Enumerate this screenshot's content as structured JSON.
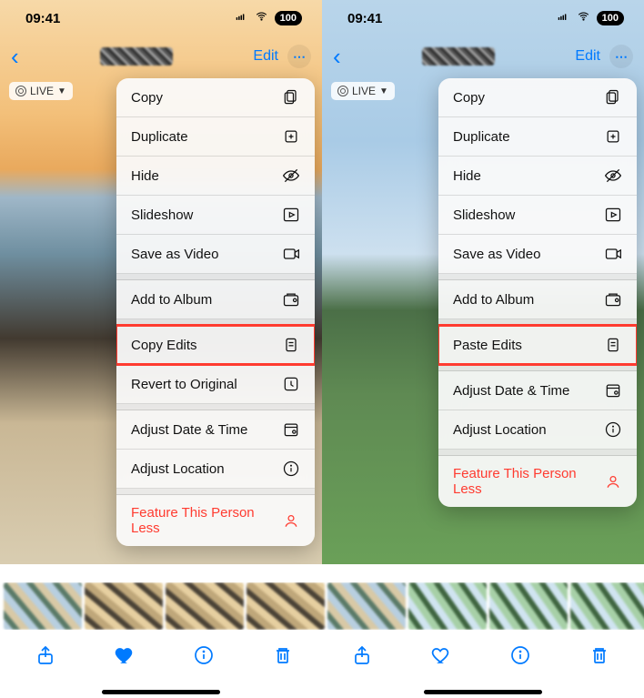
{
  "status": {
    "time": "09:41",
    "battery": "100"
  },
  "nav": {
    "edit": "Edit"
  },
  "live_badge": "LIVE",
  "menu_common": {
    "copy": "Copy",
    "duplicate": "Duplicate",
    "hide": "Hide",
    "slideshow": "Slideshow",
    "save_video": "Save as Video",
    "add_album": "Add to Album",
    "revert": "Revert to Original",
    "adjust_dt": "Adjust Date & Time",
    "adjust_loc": "Adjust Location",
    "feature_less": "Feature This Person Less"
  },
  "menu_left": {
    "highlighted": "Copy Edits"
  },
  "menu_right": {
    "highlighted": "Paste Edits"
  }
}
